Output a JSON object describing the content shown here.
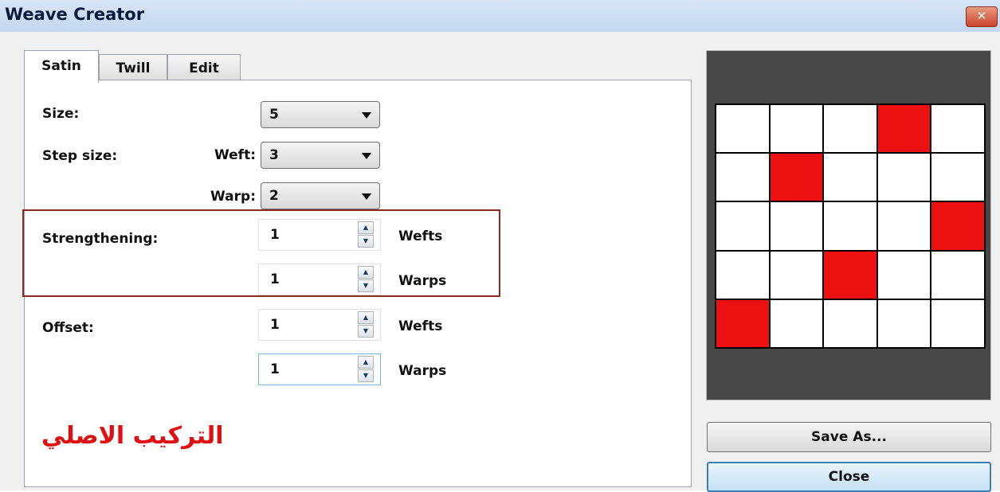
{
  "window": {
    "title": "Weave Creator",
    "close_glyph": "✕"
  },
  "tabs": [
    {
      "label": "Satin",
      "active": true
    },
    {
      "label": "Twill",
      "active": false
    },
    {
      "label": "Edit",
      "active": false
    }
  ],
  "satin": {
    "size_label": "Size:",
    "size_value": "5",
    "step_size_label": "Step size:",
    "weft_label": "Weft:",
    "weft_value": "3",
    "warp_label": "Warp:",
    "warp_value": "2",
    "strengthening_label": "Strengthening:",
    "strengthening_wefts_value": "1",
    "strengthening_warps_value": "1",
    "offset_label": "Offset:",
    "offset_wefts_value": "1",
    "offset_warps_value": "1",
    "wefts_unit": "Wefts",
    "warps_unit": "Warps"
  },
  "caption": "التركيب الاصلي",
  "preview": {
    "rows": 5,
    "cols": 5,
    "filled_cells": [
      [
        0,
        3
      ],
      [
        1,
        1
      ],
      [
        2,
        4
      ],
      [
        3,
        2
      ],
      [
        4,
        0
      ]
    ],
    "fill_color": "#ee1111",
    "background_color": "#474747"
  },
  "buttons": {
    "save_as": "Save As...",
    "close": "Close"
  },
  "icons": {
    "spin_up": "▲",
    "spin_down": "▼"
  },
  "colors": {
    "highlight_border": "#8b2a1e",
    "caption": "#e01010"
  }
}
